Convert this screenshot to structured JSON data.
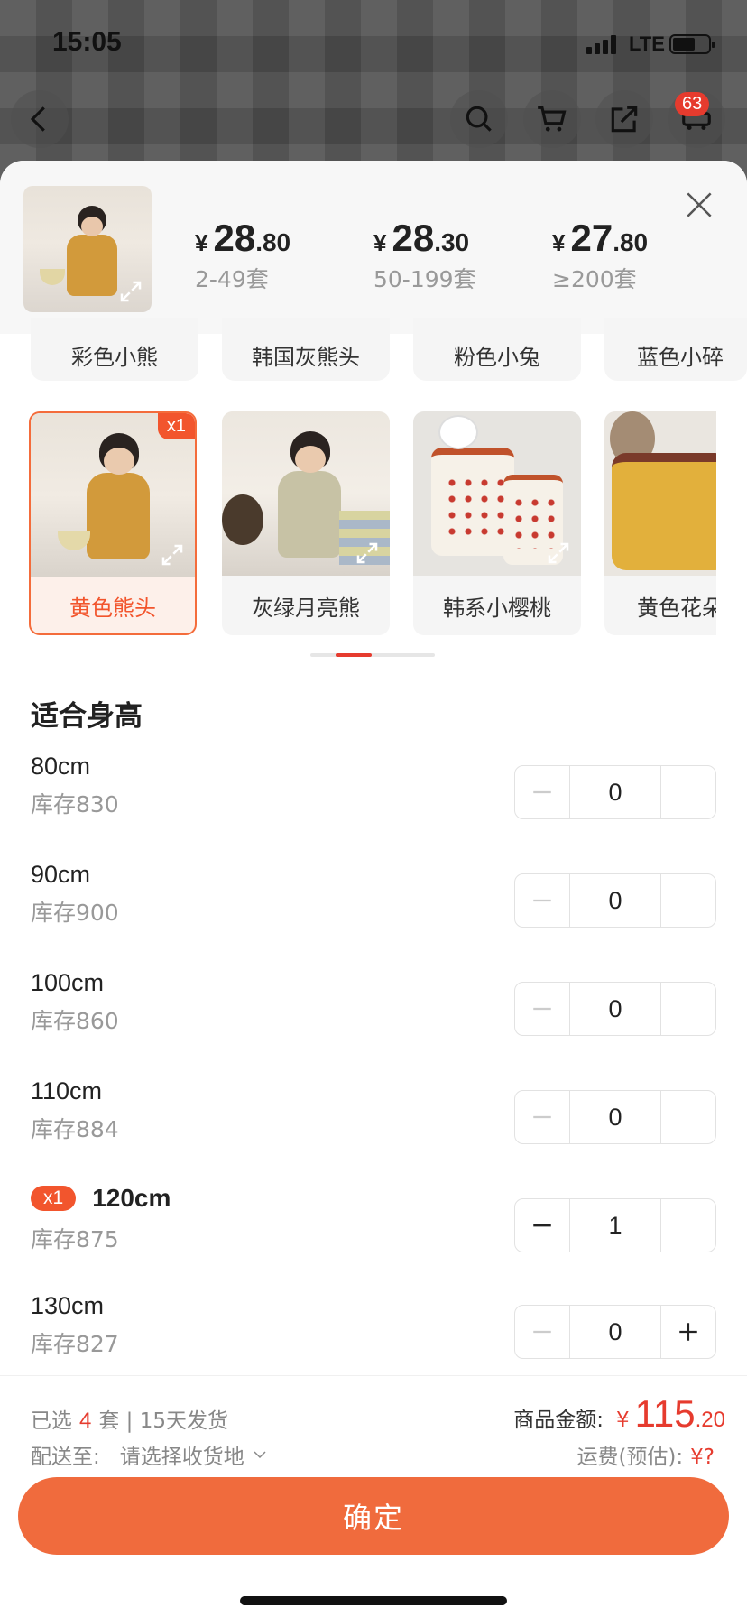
{
  "status": {
    "time": "15:05",
    "network": "LTE"
  },
  "nav": {
    "cart_badge": "63"
  },
  "header": {
    "tiers": [
      {
        "yen": "¥",
        "int": "28",
        "dec": ".80",
        "range": "2-49套"
      },
      {
        "yen": "¥",
        "int": "28",
        "dec": ".30",
        "range": "50-199套"
      },
      {
        "yen": "¥",
        "int": "27",
        "dec": ".80",
        "range": "≥200套"
      }
    ]
  },
  "top_options": [
    "彩色小熊",
    "韩国灰熊头",
    "粉色小兔",
    "蓝色小碎"
  ],
  "variants": [
    {
      "label": "黄色熊头",
      "qty_tag": "x1",
      "selected": true
    },
    {
      "label": "灰绿月亮熊",
      "selected": false
    },
    {
      "label": "韩系小樱桃",
      "selected": false
    },
    {
      "label": "黄色花朵",
      "selected": false
    }
  ],
  "section_title": "适合身高",
  "sizes": [
    {
      "name": "80cm",
      "stock": "库存830",
      "qty": "0"
    },
    {
      "name": "90cm",
      "stock": "库存900",
      "qty": "0"
    },
    {
      "name": "100cm",
      "stock": "库存860",
      "qty": "0"
    },
    {
      "name": "110cm",
      "stock": "库存884",
      "qty": "0"
    },
    {
      "name": "120cm",
      "stock": "库存875",
      "qty": "1",
      "tag": "x1"
    },
    {
      "name": "130cm",
      "stock": "库存827",
      "qty": "0"
    }
  ],
  "footer": {
    "selected_prefix": "已选",
    "selected_count": "4",
    "selected_suffix": "套 | 15天发货",
    "ship_label": "配送至:",
    "ship_value": "请选择收货地",
    "amount_label": "商品金额:",
    "amount_yen": "¥",
    "amount_int": "115",
    "amount_dec": ".20",
    "freight_label": "运费(预估):",
    "freight_value": "¥?",
    "confirm": "确定"
  },
  "colors": {
    "accent": "#f06b3d",
    "price_red": "#e63b2e"
  }
}
